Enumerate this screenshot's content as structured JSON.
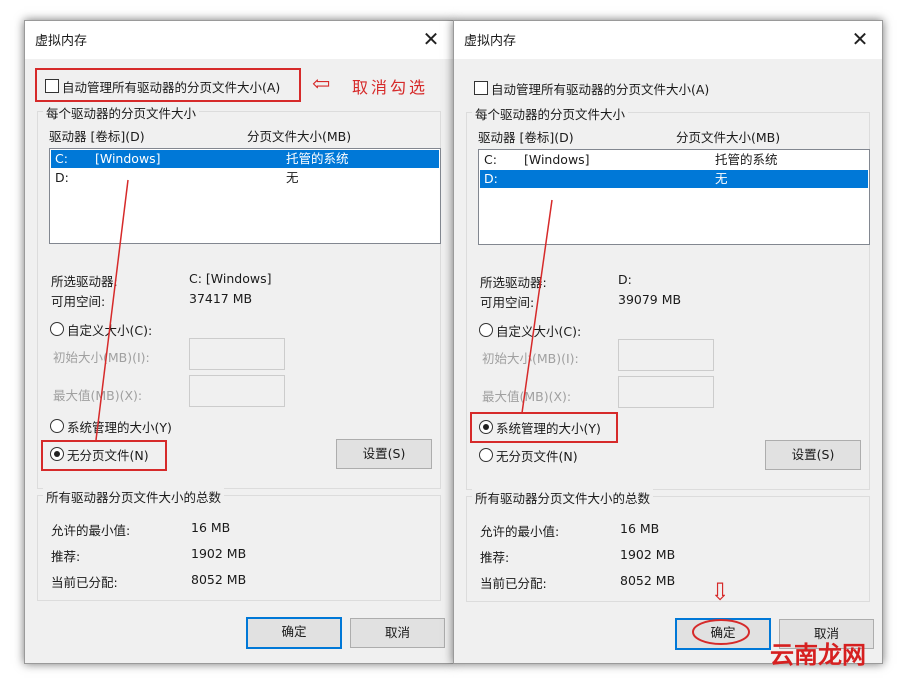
{
  "dialogs": [
    {
      "title": "虚拟内存",
      "close_glyph": "✕",
      "auto_manage_label": "自动管理所有驱动器的分页文件大小(A)",
      "auto_manage_checked": false,
      "per_drive_group_label": "每个驱动器的分页文件大小",
      "col_drive": "驱动器 [卷标](D)",
      "col_size": "分页文件大小(MB)",
      "drives": [
        {
          "drive": "C:",
          "label": "[Windows]",
          "size": "托管的系统",
          "selected": true
        },
        {
          "drive": "D:",
          "label": "",
          "size": "无",
          "selected": false
        }
      ],
      "selected_drive_label": "所选驱动器:",
      "selected_drive_value": "C:  [Windows]",
      "free_space_label": "可用空间:",
      "free_space_value": "37417 MB",
      "custom_size_label": "自定义大小(C):",
      "initial_size_label": "初始大小(MB)(I):",
      "max_size_label": "最大值(MB)(X):",
      "system_managed_label": "系统管理的大小(Y)",
      "no_paging_label": "无分页文件(N)",
      "selected_option": "no_paging",
      "set_button": "设置(S)",
      "totals_group_label": "所有驱动器分页文件大小的总数",
      "min_allowed_label": "允许的最小值:",
      "min_allowed_value": "16 MB",
      "recommended_label": "推荐:",
      "recommended_value": "1902 MB",
      "current_label": "当前已分配:",
      "current_value": "8052 MB",
      "ok_button": "确定",
      "cancel_button": "取消"
    },
    {
      "title": "虚拟内存",
      "close_glyph": "✕",
      "auto_manage_label": "自动管理所有驱动器的分页文件大小(A)",
      "auto_manage_checked": false,
      "per_drive_group_label": "每个驱动器的分页文件大小",
      "col_drive": "驱动器 [卷标](D)",
      "col_size": "分页文件大小(MB)",
      "drives": [
        {
          "drive": "C:",
          "label": "[Windows]",
          "size": "托管的系统",
          "selected": false
        },
        {
          "drive": "D:",
          "label": "",
          "size": "无",
          "selected": true
        }
      ],
      "selected_drive_label": "所选驱动器:",
      "selected_drive_value": "D:",
      "free_space_label": "可用空间:",
      "free_space_value": "39079 MB",
      "custom_size_label": "自定义大小(C):",
      "initial_size_label": "初始大小(MB)(I):",
      "max_size_label": "最大值(MB)(X):",
      "system_managed_label": "系统管理的大小(Y)",
      "no_paging_label": "无分页文件(N)",
      "selected_option": "system_managed",
      "set_button": "设置(S)",
      "totals_group_label": "所有驱动器分页文件大小的总数",
      "min_allowed_label": "允许的最小值:",
      "min_allowed_value": "16 MB",
      "recommended_label": "推荐:",
      "recommended_value": "1902 MB",
      "current_label": "当前已分配:",
      "current_value": "8052 MB",
      "ok_button": "确定",
      "cancel_button": "取消"
    }
  ],
  "annotations": {
    "uncheck_note": "取消勾选",
    "arrow_left_glyph": "⇦",
    "arrow_down_glyph": "⇩",
    "annotation_color": "#d62a2a"
  },
  "watermark": "云南龙网",
  "colors": {
    "selection": "#0078d7",
    "dialog_bg": "#f0f0f0",
    "annotation": "#d62a2a"
  }
}
